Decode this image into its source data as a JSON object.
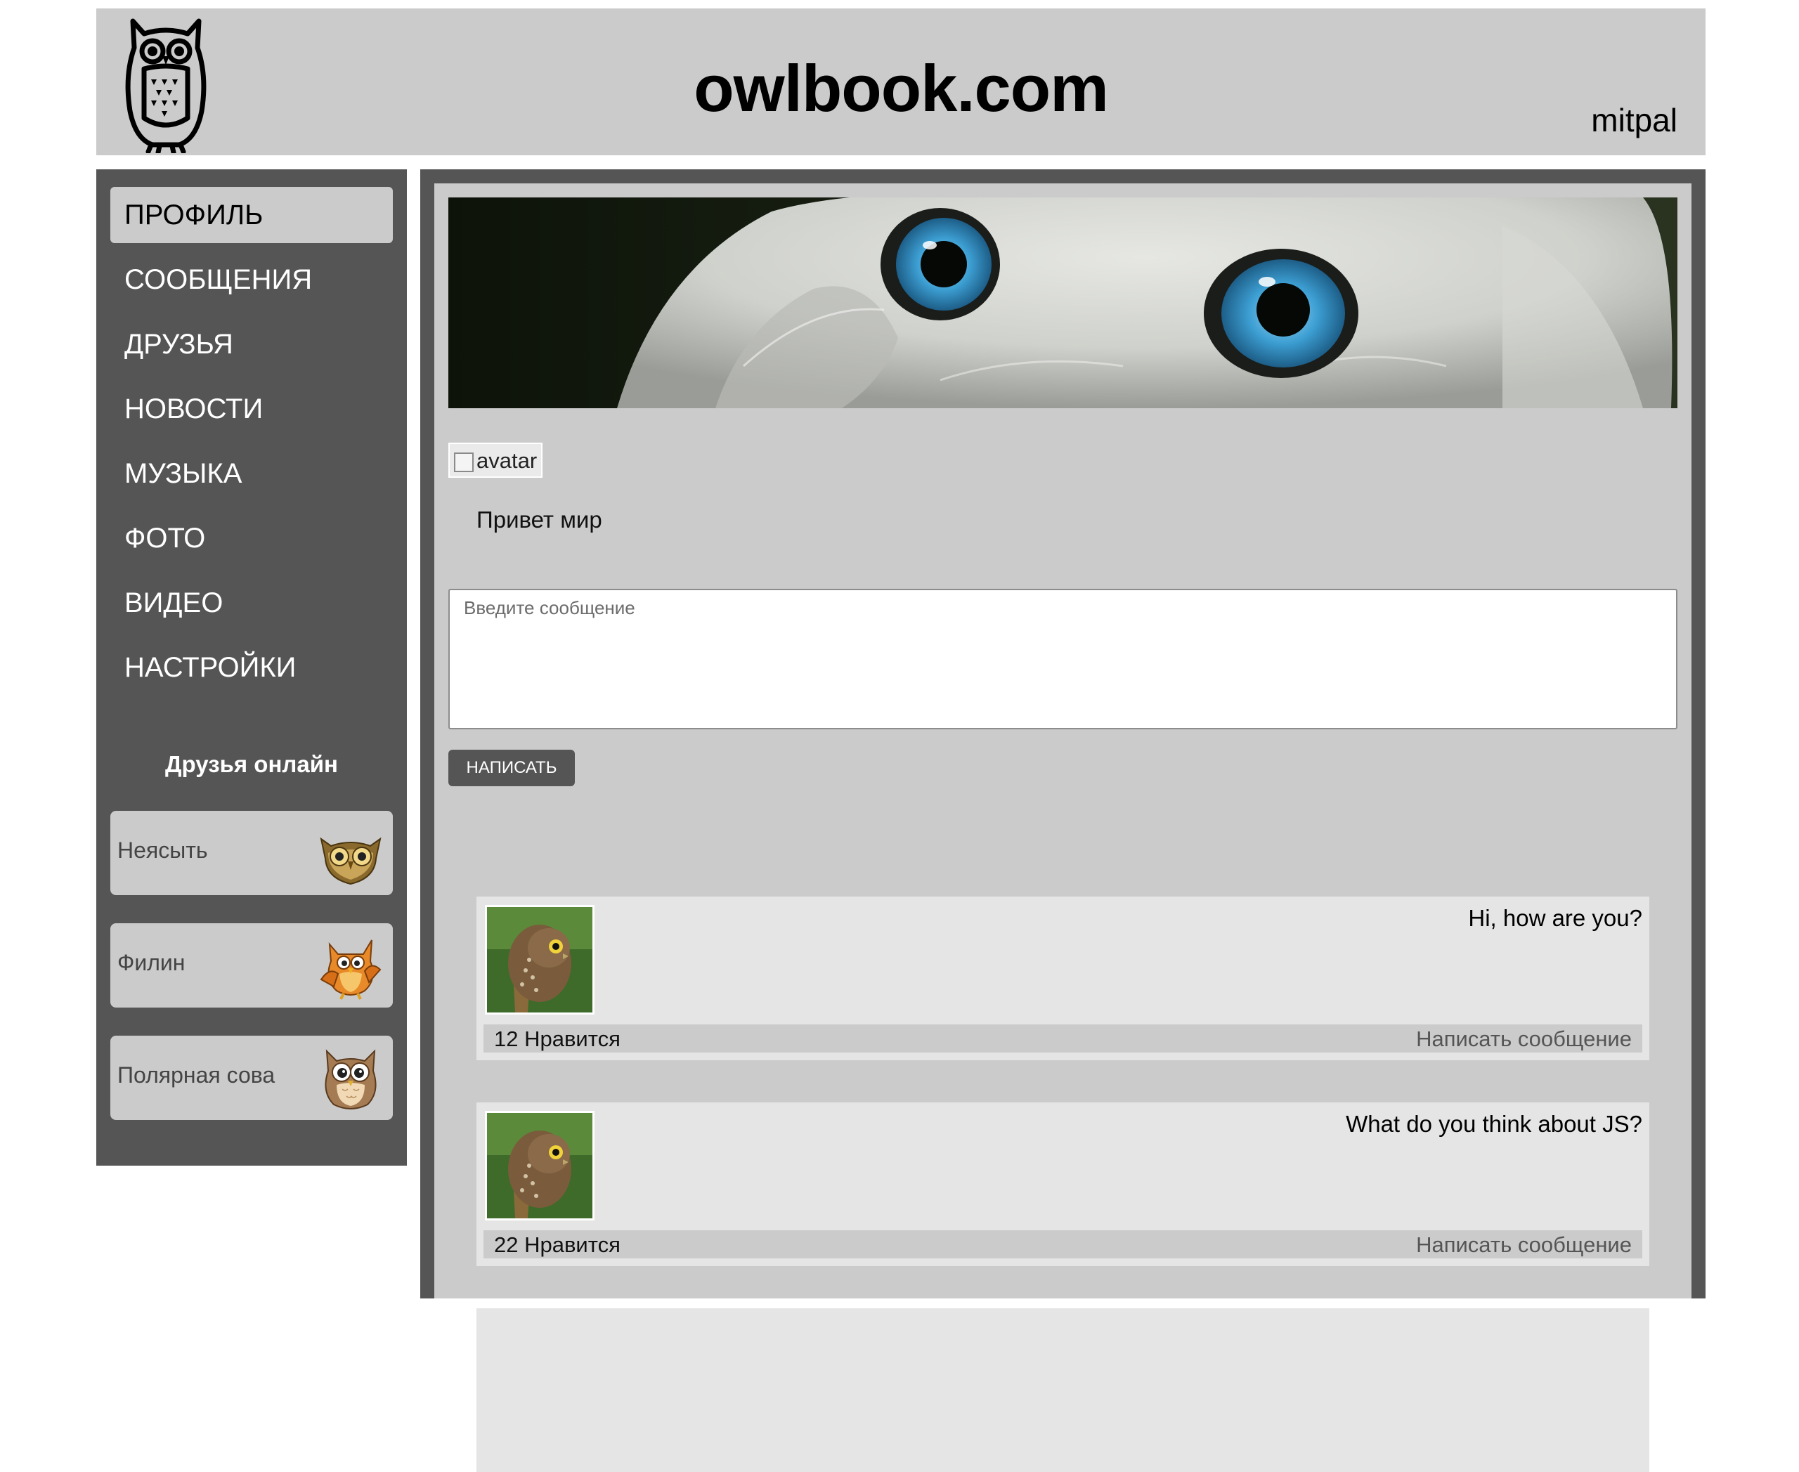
{
  "header": {
    "site_title": "owlbook.com",
    "username": "mitpal",
    "logo_icon": "owl-logo-icon"
  },
  "sidebar": {
    "nav": [
      {
        "label": "ПРОФИЛЬ",
        "active": true
      },
      {
        "label": "СООБЩЕНИЯ",
        "active": false
      },
      {
        "label": "ДРУЗЬЯ",
        "active": false
      },
      {
        "label": "НОВОСТИ",
        "active": false
      },
      {
        "label": "МУЗЫКА",
        "active": false
      },
      {
        "label": "ФОТО",
        "active": false
      },
      {
        "label": "ВИДЕО",
        "active": false
      },
      {
        "label": "НАСТРОЙКИ",
        "active": false
      }
    ],
    "friends_title": "Друзья онлайн",
    "friends": [
      {
        "name": "Неясыть",
        "avatar_icon": "tawny-owl-icon"
      },
      {
        "name": "Филин",
        "avatar_icon": "cartoon-owl-icon"
      },
      {
        "name": "Полярная сова",
        "avatar_icon": "brown-owl-icon"
      }
    ]
  },
  "profile": {
    "banner_image": "owl-eyes-banner",
    "avatar_alt": "avatar",
    "status": "Привет мир",
    "input_placeholder": "Введите сообщение",
    "send_label": "НАПИСАТЬ"
  },
  "posts": [
    {
      "text": "Hi, how are you?",
      "likes": "12 Нравится",
      "write_label": "Написать сообщение"
    },
    {
      "text": "What do you think about JS?",
      "likes": "22 Нравится",
      "write_label": "Написать сообщение"
    }
  ],
  "colors": {
    "dark_gray": "#555555",
    "light_gray": "#cbcbcb",
    "post_bg": "#e5e5e5"
  }
}
